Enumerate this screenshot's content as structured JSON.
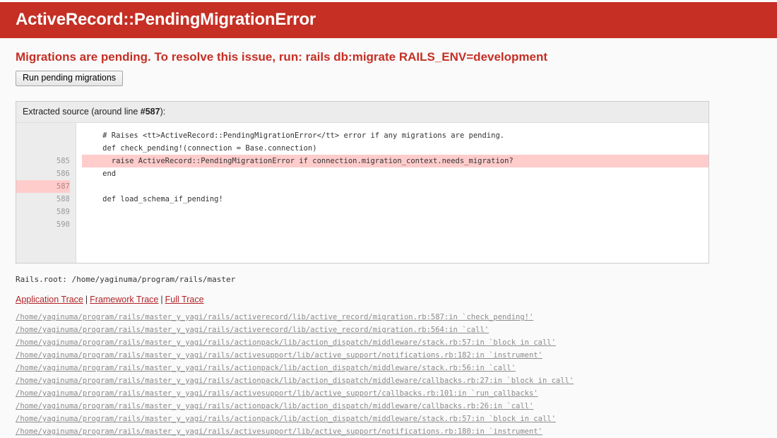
{
  "header": {
    "title": "ActiveRecord::PendingMigrationError",
    "bg_color": "#C52F24"
  },
  "message": {
    "text": "Migrations are pending. To resolve this issue, run: rails db:migrate RAILS_ENV=development",
    "color": "#C52F24"
  },
  "button": {
    "label": "Run pending migrations"
  },
  "source": {
    "title_prefix": "Extracted source (around line ",
    "title_line": "#587",
    "title_suffix": "):",
    "highlight_color": "#FFCCCC",
    "lines": [
      {
        "number": "585",
        "code": "    # Raises <tt>ActiveRecord::PendingMigrationError</tt> error if any migrations are pending.",
        "highlight": false
      },
      {
        "number": "586",
        "code": "    def check_pending!(connection = Base.connection)",
        "highlight": false
      },
      {
        "number": "587",
        "code": "      raise ActiveRecord::PendingMigrationError if connection.migration_context.needs_migration?",
        "highlight": true
      },
      {
        "number": "588",
        "code": "    end",
        "highlight": false
      },
      {
        "number": "589",
        "code": "",
        "highlight": false
      },
      {
        "number": "590",
        "code": "    def load_schema_if_pending!",
        "highlight": false
      }
    ]
  },
  "rails_root": {
    "label": "Rails.root:",
    "path": "/home/yaginuma/program/rails/master",
    "text": "Rails.root: /home/yaginuma/program/rails/master"
  },
  "trace_tabs": {
    "items": [
      {
        "label": "Application Trace"
      },
      {
        "label": "Framework Trace"
      },
      {
        "label": "Full Trace"
      }
    ],
    "separator": "|"
  },
  "backtrace": {
    "lines": [
      "/home/yaginuma/program/rails/master_y_yagi/rails/activerecord/lib/active_record/migration.rb:587:in `check_pending!'",
      "/home/yaginuma/program/rails/master_y_yagi/rails/activerecord/lib/active_record/migration.rb:564:in `call'",
      "/home/yaginuma/program/rails/master_y_yagi/rails/actionpack/lib/action_dispatch/middleware/stack.rb:57:in `block in call'",
      "/home/yaginuma/program/rails/master_y_yagi/rails/activesupport/lib/active_support/notifications.rb:182:in `instrument'",
      "/home/yaginuma/program/rails/master_y_yagi/rails/actionpack/lib/action_dispatch/middleware/stack.rb:56:in `call'",
      "/home/yaginuma/program/rails/master_y_yagi/rails/actionpack/lib/action_dispatch/middleware/callbacks.rb:27:in `block in call'",
      "/home/yaginuma/program/rails/master_y_yagi/rails/activesupport/lib/active_support/callbacks.rb:101:in `run_callbacks'",
      "/home/yaginuma/program/rails/master_y_yagi/rails/actionpack/lib/action_dispatch/middleware/callbacks.rb:26:in `call'",
      "/home/yaginuma/program/rails/master_y_yagi/rails/actionpack/lib/action_dispatch/middleware/stack.rb:57:in `block in call'",
      "/home/yaginuma/program/rails/master_y_yagi/rails/activesupport/lib/active_support/notifications.rb:180:in `instrument'"
    ]
  }
}
